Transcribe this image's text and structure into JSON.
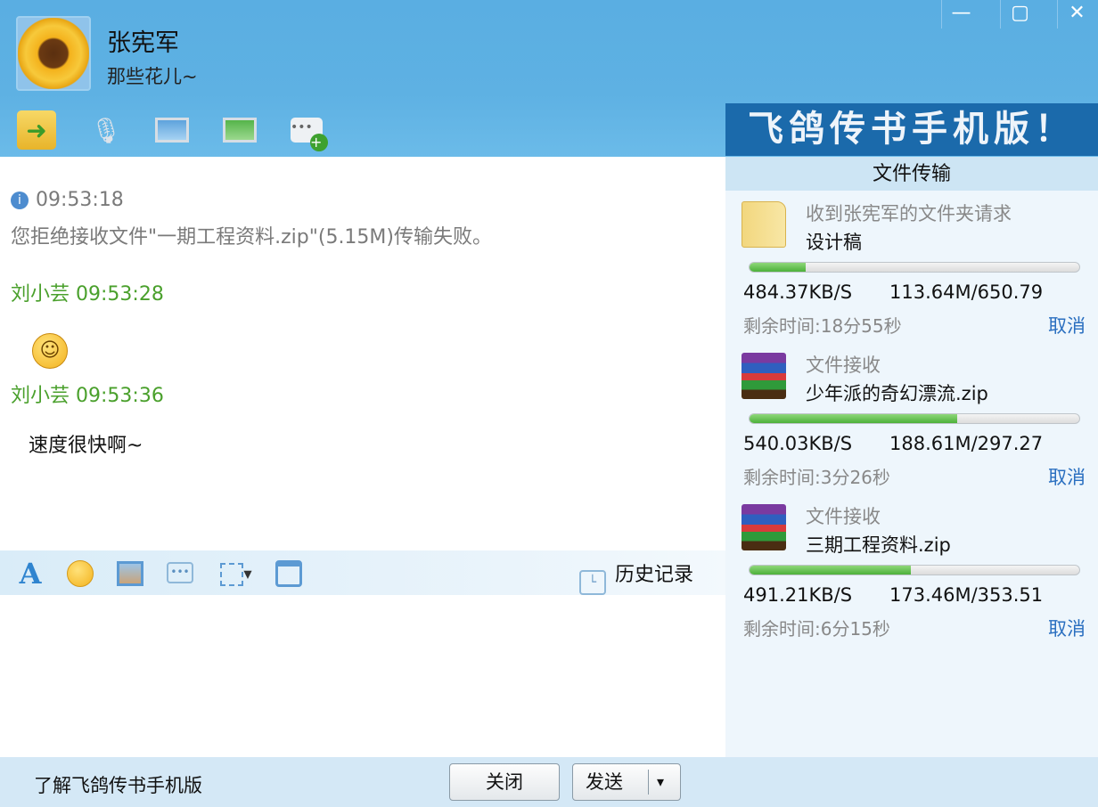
{
  "contact": {
    "name": "张宪军",
    "signature": "那些花儿~"
  },
  "window": {
    "minimize": "—",
    "maximize": "▢",
    "close": "✕"
  },
  "toolbar": [
    "file-transfer",
    "microphone",
    "video",
    "remote-desktop",
    "add-chat"
  ],
  "banner": "飞鸽传书手机版！",
  "chat": {
    "messages": [
      {
        "time": "09:53:18",
        "text": "您拒绝接收文件\"一期工程资料.zip\"(5.15M)传输失败。"
      },
      {
        "sender": "刘小芸",
        "time": "09:53:28",
        "emoji": "☺"
      },
      {
        "sender": "刘小芸",
        "time": "09:53:36",
        "text": "速度很快啊~"
      }
    ]
  },
  "input_toolbar": {
    "history": "历史记录"
  },
  "transfer": {
    "title": "文件传输",
    "items": [
      {
        "label": "收到张宪军的文件夹请求",
        "name": "设计稿",
        "progress": 0.17,
        "speed": "484.37KB/S",
        "size": "113.64M/650.79",
        "remaining": "剩余时间:18分55秒",
        "cancel": "取消",
        "icon": "folder-icon"
      },
      {
        "label": "文件接收",
        "name": "少年派的奇幻漂流.zip",
        "progress": 0.63,
        "speed": "540.03KB/S",
        "size": "188.61M/297.27",
        "remaining": "剩余时间:3分26秒",
        "cancel": "取消",
        "icon": "rar-archive-icon"
      },
      {
        "label": "文件接收",
        "name": "三期工程资料.zip",
        "progress": 0.49,
        "speed": "491.21KB/S",
        "size": "173.46M/353.51",
        "remaining": "剩余时间:6分15秒",
        "cancel": "取消",
        "icon": "rar-archive-icon"
      }
    ]
  },
  "footer": {
    "learn": "了解飞鸽传书手机版",
    "close": "关闭",
    "send": "发送",
    "send_arrow": "▾"
  }
}
